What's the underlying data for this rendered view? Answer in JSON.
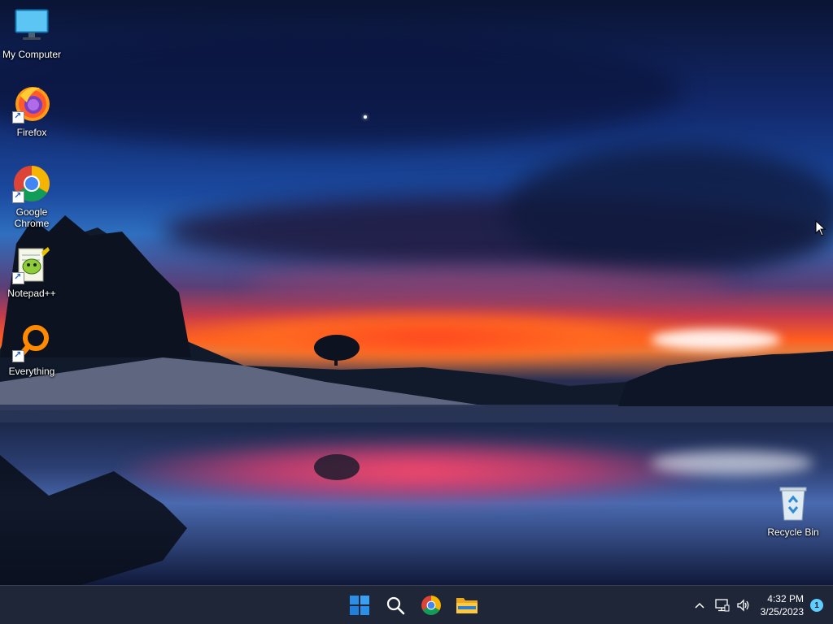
{
  "desktop": {
    "icons": [
      {
        "label": "My Computer",
        "icon": "monitor-icon"
      },
      {
        "label": "Firefox",
        "icon": "firefox-icon"
      },
      {
        "label": "Google Chrome",
        "icon": "chrome-icon"
      },
      {
        "label": "Notepad++",
        "icon": "notepadpp-icon"
      },
      {
        "label": "Everything",
        "icon": "everything-search-icon"
      }
    ],
    "recycle_bin": {
      "label": "Recycle Bin",
      "icon": "recycle-bin-icon"
    }
  },
  "taskbar": {
    "pinned": [
      {
        "name": "start",
        "icon": "windows-start-icon"
      },
      {
        "name": "search",
        "icon": "search-icon"
      },
      {
        "name": "chrome",
        "icon": "chrome-icon"
      },
      {
        "name": "file-explorer",
        "icon": "folder-icon"
      }
    ],
    "tray": {
      "chevron_icon": "chevron-up-icon",
      "network_icon": "network-icon",
      "volume_icon": "volume-icon",
      "time": "4:32 PM",
      "date": "3/25/2023",
      "notification_count": "1"
    }
  },
  "colors": {
    "taskbar_bg": "#1f2638",
    "notification_badge": "#60cdff",
    "start_blue": "#2b8fe8"
  }
}
